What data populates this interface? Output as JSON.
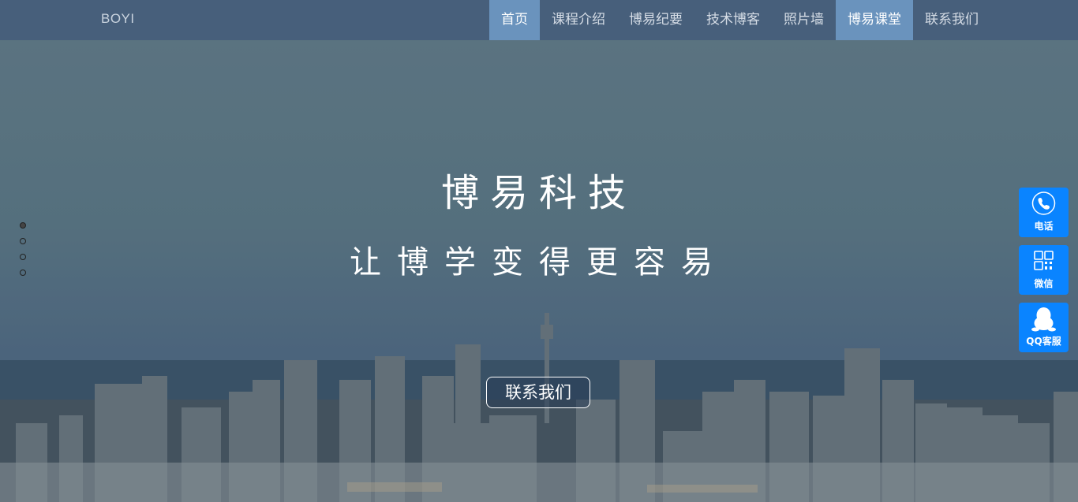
{
  "brand": "BOYI",
  "nav": {
    "items": [
      {
        "label": "首页"
      },
      {
        "label": "课程介绍"
      },
      {
        "label": "博易纪要"
      },
      {
        "label": "技术博客"
      },
      {
        "label": "照片墙"
      },
      {
        "label": "博易课堂"
      },
      {
        "label": "联系我们"
      }
    ]
  },
  "hero": {
    "headline": "博易科技",
    "tagline": "让博学变得更容易",
    "contact_button": "联系我们"
  },
  "side": {
    "phone_label": "电话",
    "wechat_label": "微信",
    "qq_label": "QQ客服"
  },
  "pagination": {
    "count": 4,
    "active": 1
  },
  "colors": {
    "accent": "#0a84ff",
    "nav_bg": "#475f7b",
    "nav_active": "#6a93bd"
  }
}
